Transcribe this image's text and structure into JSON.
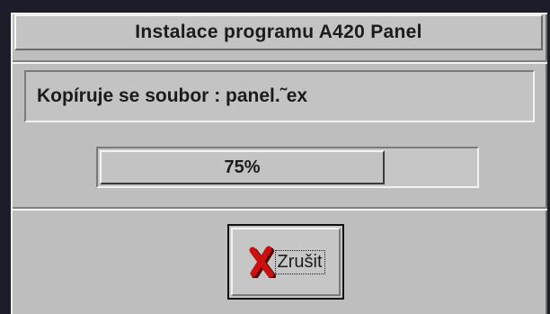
{
  "dialog": {
    "title": "Instalace programu A420 Panel"
  },
  "status": {
    "prefix": "Kopíruje se soubor : ",
    "filename": "panel.˜ex"
  },
  "progress": {
    "value": 0.75,
    "label": "75%"
  },
  "cancel": {
    "label": "Zrušit",
    "icon": "red-x-icon",
    "icon_color": "#cc1010"
  }
}
